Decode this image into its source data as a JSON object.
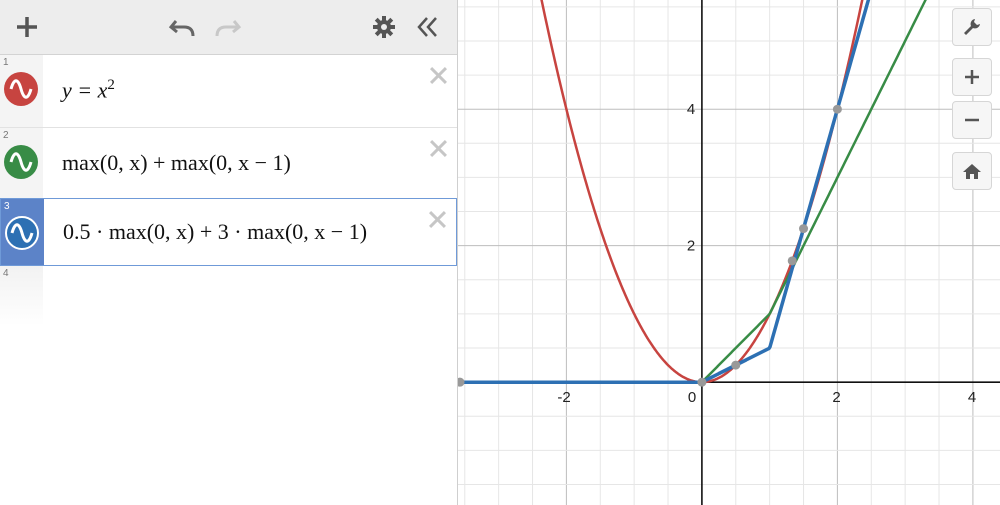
{
  "expressions": [
    {
      "num": "1",
      "color": "#c74440",
      "parts": [
        "y = x",
        "2"
      ]
    },
    {
      "num": "2",
      "color": "#388c46",
      "latex": "max(0, x) + max(0, x − 1)"
    },
    {
      "num": "3",
      "color": "#2d70b3",
      "latex": "0.5 · max(0, x) + 3 · max(0, x − 1)"
    },
    {
      "num": "4"
    }
  ],
  "graph": {
    "x_ticks": [
      "-2",
      "0",
      "2",
      "4"
    ],
    "y_ticks": [
      "4",
      "2"
    ],
    "xlim": [
      -3.6,
      4.4
    ],
    "ylim": [
      -1.8,
      5.6
    ]
  },
  "icons": {
    "add": "plus-icon",
    "undo": "undo-icon",
    "redo": "redo-icon",
    "settings": "gear-icon",
    "collapse": "double-chevron-left-icon",
    "wrench": "wrench-icon",
    "zoom_in": "plus-icon",
    "zoom_out": "minus-icon",
    "home": "home-icon"
  }
}
